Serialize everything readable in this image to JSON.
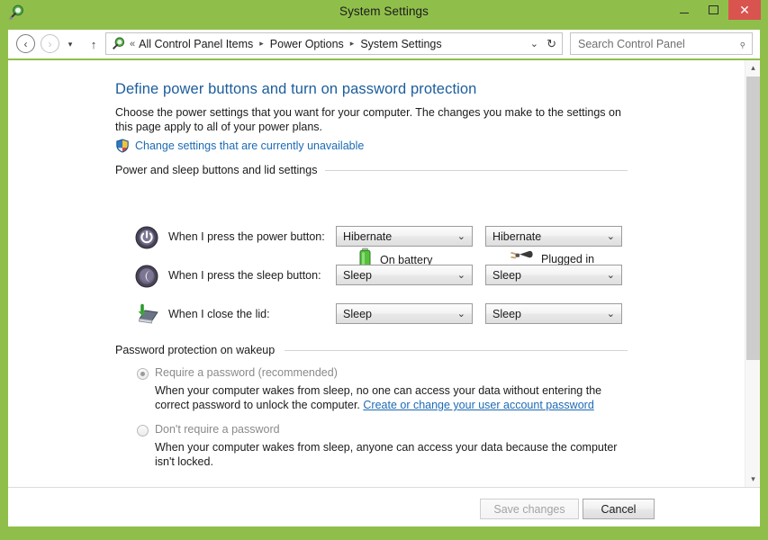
{
  "window": {
    "title": "System Settings",
    "app_icon": "power-plug-icon",
    "controls": {
      "minimize": "–",
      "maximize": "□",
      "close": "✕",
      "close_color": "#d9534f"
    },
    "titlebar_color": "#8fbf4a"
  },
  "nav": {
    "back": "‹",
    "forward": "›",
    "recent": "▾",
    "up": "↑",
    "breadcrumb_prefix": "«",
    "breadcrumb": [
      "All Control Panel Items",
      "Power Options",
      "System Settings"
    ],
    "breadcrumb_arrow": "▸",
    "dropdown": "⌄",
    "refresh": "↻"
  },
  "search": {
    "placeholder": "Search Control Panel",
    "icon": "search-icon"
  },
  "page": {
    "title": "Define power buttons and turn on password protection",
    "intro": "Choose the power settings that you want for your computer. The changes you make to the settings on this page apply to all of your power plans.",
    "uac_link": "Change settings that are currently unavailable",
    "link_color": "#1c6bb5",
    "title_color": "#1b5d9c"
  },
  "buttons_group": {
    "heading": "Power and sleep buttons and lid settings",
    "columns": [
      {
        "label": "On battery",
        "icon": "battery-icon"
      },
      {
        "label": "Plugged in",
        "icon": "power-plug-icon"
      }
    ],
    "rows": [
      {
        "icon": "power-button-icon",
        "label": "When I press the power button:",
        "on_battery": "Hibernate",
        "plugged_in": "Hibernate"
      },
      {
        "icon": "sleep-moon-icon",
        "label": "When I press the sleep button:",
        "on_battery": "Sleep",
        "plugged_in": "Sleep"
      },
      {
        "icon": "laptop-lid-icon",
        "label": "When I close the lid:",
        "on_battery": "Sleep",
        "plugged_in": "Sleep"
      }
    ],
    "combo_arrow": "⌄"
  },
  "password_group": {
    "heading": "Password protection on wakeup",
    "options": [
      {
        "label": "Require a password (recommended)",
        "selected": true,
        "description_before": "When your computer wakes from sleep, no one can access your data without entering the correct password to unlock the computer. ",
        "description_link": "Create or change your user account password",
        "description_after": ""
      },
      {
        "label": "Don't require a password",
        "selected": false,
        "description_before": "When your computer wakes from sleep, anyone can access your data because the computer isn't locked.",
        "description_link": "",
        "description_after": ""
      }
    ]
  },
  "footer": {
    "save_label": "Save changes",
    "save_enabled": false,
    "cancel_label": "Cancel",
    "cancel_enabled": true
  },
  "scrollbar": {
    "up_arrow": "▴",
    "down_arrow": "▾"
  }
}
